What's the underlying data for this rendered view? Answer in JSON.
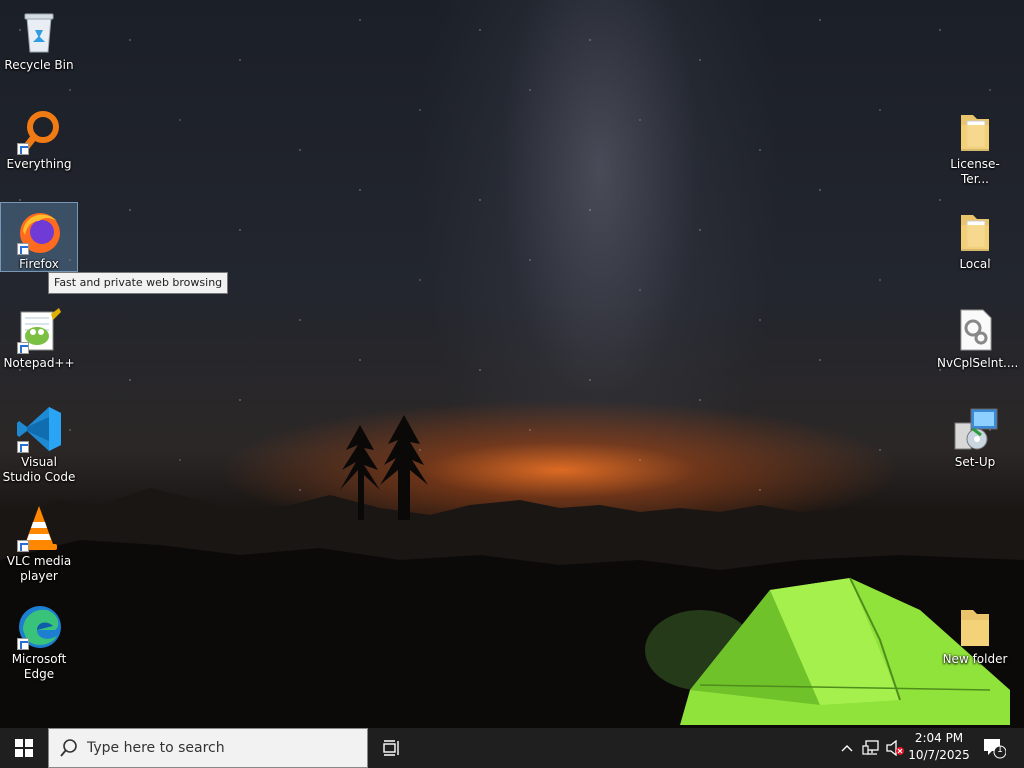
{
  "desktop": {
    "left_icons": [
      {
        "label": "Recycle Bin",
        "icon": "recycle-bin-icon"
      },
      {
        "label": "Everything",
        "icon": "everything-search-icon"
      },
      {
        "label": "Firefox",
        "icon": "firefox-icon"
      },
      {
        "label": "Notepad++",
        "icon": "notepad-plus-plus-icon"
      },
      {
        "label": "Visual Studio Code",
        "icon": "vscode-icon"
      },
      {
        "label": "VLC media player",
        "icon": "vlc-icon"
      },
      {
        "label": "Microsoft Edge",
        "icon": "edge-icon"
      }
    ],
    "right_icons": [
      {
        "label": "License-Ter...",
        "icon": "folder-icon"
      },
      {
        "label": "Local",
        "icon": "folder-icon"
      },
      {
        "label": "NvCplSelnt....",
        "icon": "settings-file-icon"
      },
      {
        "label": "Set-Up",
        "icon": "setup-installer-icon"
      },
      {
        "label": "New folder",
        "icon": "folder-icon"
      }
    ],
    "selected": "Firefox",
    "tooltip": "Fast and private web browsing"
  },
  "taskbar": {
    "search_placeholder": "Type here to search",
    "time": "2:04 PM",
    "date": "10/7/2025",
    "notification_count": "1",
    "icons": [
      "windows-start-icon",
      "search-icon",
      "task-view-icon",
      "chevron-up-icon",
      "network-icon",
      "volume-muted-icon",
      "notification-icon"
    ]
  },
  "colors": {
    "taskbar": "#1f1f1f",
    "search_bg": "#f2f2f2",
    "tent_green": "#8fe33a",
    "glow_orange": "#e06a23"
  }
}
